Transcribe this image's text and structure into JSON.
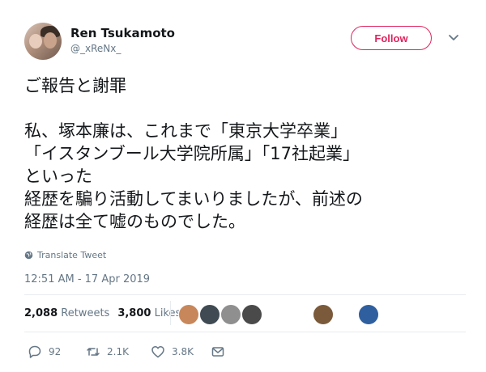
{
  "user": {
    "display_name": "Ren Tsukamoto",
    "handle": "@_xReNx_"
  },
  "follow_button": {
    "label": "Follow"
  },
  "tweet": {
    "lines": [
      "ご報告と謝罪",
      "",
      "私、塚本廉は、これまで「東京大学卒業」",
      "「イスタンブール大学院所属」「17社起業」",
      "といった",
      "経歴を騙り活動してまいりましたが、前述の",
      "経歴は全て嘘のものでした。"
    ],
    "translate_label": "Translate Tweet",
    "timestamp": "12:51 AM - 17 Apr 2019"
  },
  "stats": {
    "retweets_count": "2,088",
    "retweets_label": "Retweets",
    "likes_count": "3,800",
    "likes_label": "Likes"
  },
  "likers": [
    {
      "name": "liker-avatar-1",
      "color": "#c8875a"
    },
    {
      "name": "liker-avatar-2",
      "color": "#3f4a52"
    },
    {
      "name": "liker-avatar-3",
      "color": "#8f8f8f"
    },
    {
      "name": "liker-avatar-4",
      "color": "#4a4a4a"
    },
    {
      "name": "liker-avatar-5",
      "color": "#7a5a3a"
    },
    {
      "name": "liker-avatar-6",
      "color": "#2f5f9f"
    }
  ],
  "actions": {
    "reply_count": "92",
    "retweet_count": "2.1K",
    "like_count": "3.8K"
  },
  "colors": {
    "accent": "#e0245e",
    "secondary_text": "#657786",
    "divider": "#e6ecf0"
  }
}
